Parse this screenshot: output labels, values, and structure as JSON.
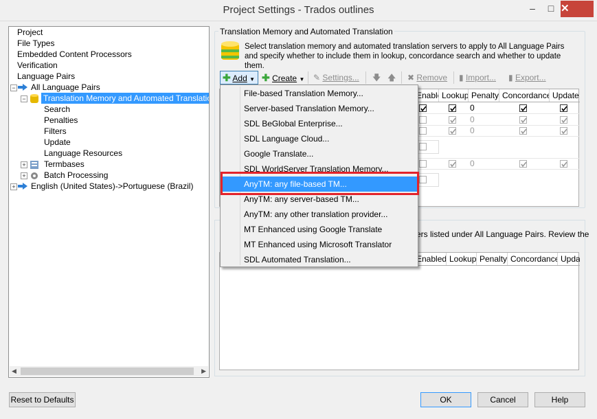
{
  "window": {
    "title": "Project Settings - Trados outlines",
    "minimize": "–",
    "maximize": "□",
    "close": "✕"
  },
  "tree": {
    "items": [
      {
        "label": "Project"
      },
      {
        "label": "File Types"
      },
      {
        "label": "Embedded Content Processors"
      },
      {
        "label": "Verification"
      },
      {
        "label": "Language Pairs"
      },
      {
        "label": "All Language Pairs"
      },
      {
        "label": "Translation Memory and Automated Translation"
      },
      {
        "label": "Search"
      },
      {
        "label": "Penalties"
      },
      {
        "label": "Filters"
      },
      {
        "label": "Update"
      },
      {
        "label": "Language Resources"
      },
      {
        "label": "Termbases"
      },
      {
        "label": "Batch Processing"
      },
      {
        "label": "English (United States)->Portuguese (Brazil)"
      }
    ]
  },
  "panel": {
    "group_title": "Translation Memory and Automated Translation",
    "description": "Select translation memory and automated translation servers to apply to All Language Pairs and specify whether to include them in lookup, concordance search and whether to update them.",
    "toolbar": {
      "add": "Add",
      "create": "Create",
      "settings": "Settings...",
      "remove": "Remove",
      "import": "Import...",
      "export": "Export..."
    },
    "columns": [
      "Enabled",
      "Lookup",
      "Penalty",
      "Concordance",
      "Update"
    ],
    "rows": [
      {
        "penalty": "0",
        "enabled": true
      },
      {
        "penalty": "0",
        "enabled": false
      },
      {
        "penalty": "0",
        "enabled": false
      },
      {
        "penalty": "0",
        "enabled": false
      }
    ],
    "lower_text": "ers listed under All Language Pairs. Review the",
    "lower_columns": [
      "Enabled",
      "Lookup",
      "Penalty",
      "Concordance",
      "Upda"
    ]
  },
  "menu": {
    "items": [
      "File-based Translation Memory...",
      "Server-based Translation Memory...",
      "SDL BeGlobal Enterprise...",
      "SDL Language Cloud...",
      "Google Translate...",
      "SDL WorldServer Translation Memory...",
      "AnyTM: any file-based TM...",
      "AnyTM: any server-based TM...",
      "AnyTM: any other translation provider...",
      "MT Enhanced using Google Translate",
      "MT Enhanced using Microsoft Translator",
      "SDL Automated Translation..."
    ],
    "highlighted_index": 6
  },
  "buttons": {
    "reset": "Reset to Defaults",
    "ok": "OK",
    "cancel": "Cancel",
    "help": "Help"
  },
  "colors": {
    "selection": "#3399ff",
    "highlight_border": "#e3232a",
    "close_button": "#c7443a"
  }
}
